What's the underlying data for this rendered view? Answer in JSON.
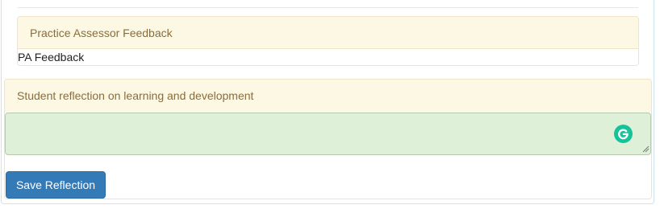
{
  "practice_assessor": {
    "heading": "Practice Assessor Feedback",
    "body": "PA Feedback"
  },
  "student_reflection": {
    "heading": "Student reflection on learning and development",
    "value": "",
    "save_label": "Save Reflection",
    "grammarly_icon": "grammarly-g-icon"
  },
  "colors": {
    "heading_bg": "#fcf8e3",
    "heading_text": "#8a6d3b",
    "textarea_bg": "#dff0d8",
    "button_bg": "#337ab7",
    "grammarly_green": "#15c39a"
  }
}
